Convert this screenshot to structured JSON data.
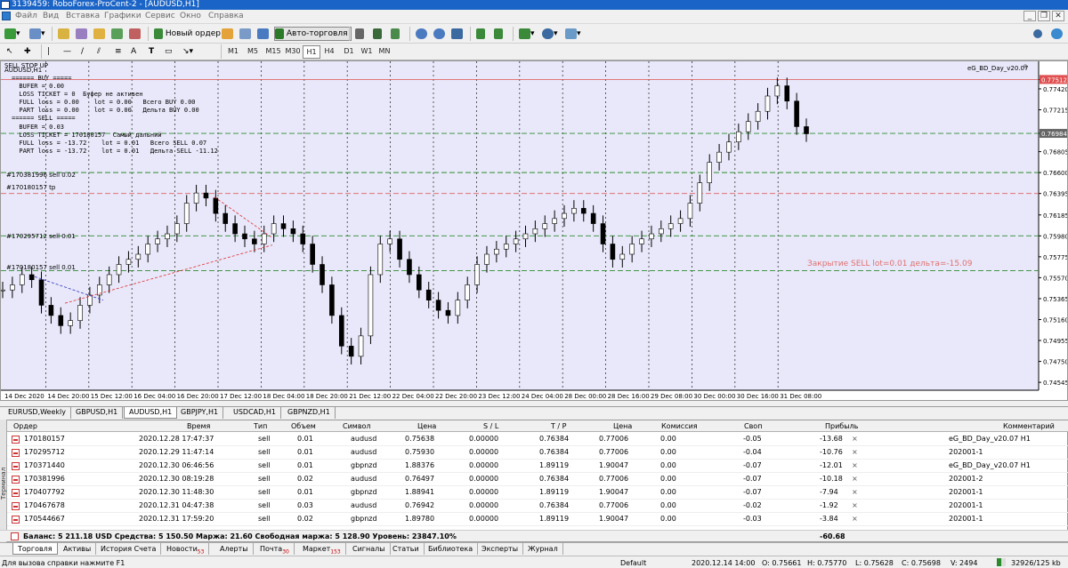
{
  "window": {
    "title": "3139459: RoboForex-ProCent-2 - [AUDUSD,H1]"
  },
  "menu": [
    "Файл",
    "Вид",
    "Вставка",
    "Графики",
    "Сервис",
    "Окно",
    "Справка"
  ],
  "toolbar": {
    "new_order": "Новый ордер",
    "auto_trading": "Авто-торговля",
    "timeframes": [
      "M1",
      "M5",
      "M15",
      "M30",
      "H1",
      "H4",
      "D1",
      "W1",
      "MN"
    ],
    "active_timeframe": "H1"
  },
  "chart": {
    "header": "SELL STOP UP",
    "symbol_line": "AUDUSD,H1",
    "expert_label": "eG_BD_Day_v20.07",
    "price_ticks": [
      "0.77512",
      "0.77420",
      "0.77215",
      "0.76984",
      "0.76805",
      "0.76600",
      "0.76395",
      "0.76185",
      "0.75980",
      "0.75775",
      "0.75570",
      "0.75365",
      "0.75160",
      "0.74955",
      "0.74750",
      "0.74545"
    ],
    "bid_price": "0.76984",
    "red_price": "0.77512",
    "time_ticks": [
      "14 Dec 2020",
      "14 Dec 20:00",
      "15 Dec 12:00",
      "16 Dec 04:00",
      "16 Dec 20:00",
      "17 Dec 12:00",
      "18 Dec 04:00",
      "18 Dec 20:00",
      "21 Dec 12:00",
      "22 Dec 04:00",
      "22 Dec 20:00",
      "23 Dec 12:00",
      "24 Dec 04:00",
      "28 Dec 00:00",
      "28 Dec 16:00",
      "29 Dec 08:00",
      "30 Dec 00:00",
      "30 Dec 16:00",
      "31 Dec 08:00"
    ],
    "buy_block": [
      "====== BUY =====",
      "  BUFER = 0.00",
      "  LOSS TICKET = 0  Буфер не активен",
      "  FULL loss = 0.00    lot = 0.00   Всего BUY 0.00",
      "  PART loss = 0.00    lot = 0.00   Дельта BUY 0.00",
      "====== SELL ====="
    ],
    "sell_block": [
      "  BUFER = 0.03",
      "  LOSS TICKET = 170180157  Самый дальний",
      "  FULL loss = -13.72    lot = 0.01   Всего SELL 0.07",
      "  PART loss = -13.72    lot = 0.01   Дельта SELL -11.12"
    ],
    "line_labels": [
      "#170381996 sell 0.02",
      "#170180157 tp",
      "#170295712 sell 0.01",
      "#170180157 sell 0.01"
    ],
    "close_note": "Закрытие SELL lot=0.01 дельта=-15.09",
    "colors": {
      "bg": "#ffffff",
      "grid": "#000000",
      "candle": "#000000",
      "hline_green": "#2e8b2e",
      "hline_red": "#e06060",
      "bid_line": "#555555"
    }
  },
  "symbol_tabs": [
    "EURUSD,Weekly",
    "GBPUSD,H1",
    "AUDUSD,H1",
    "GBPJPY,H1",
    "USDCAD,H1",
    "GBPNZD,H1"
  ],
  "active_symbol_tab": "AUDUSD,H1",
  "terminal": {
    "columns": [
      "Ордер",
      "Время",
      "Тип",
      "Объем",
      "Символ",
      "Цена",
      "S / L",
      "T / P",
      "Цена",
      "Комиссия",
      "Своп",
      "Прибыль",
      "Комментарий"
    ],
    "rows": [
      [
        "170180157",
        "2020.12.28 17:47:37",
        "sell",
        "0.01",
        "audusd",
        "0.75638",
        "0.00000",
        "0.76384",
        "0.77006",
        "0.00",
        "-0.05",
        "-13.68",
        "eG_BD_Day_v20.07 H1"
      ],
      [
        "170295712",
        "2020.12.29 11:47:14",
        "sell",
        "0.01",
        "audusd",
        "0.75930",
        "0.00000",
        "0.76384",
        "0.77006",
        "0.00",
        "-0.04",
        "-10.76",
        "202001-1"
      ],
      [
        "170371440",
        "2020.12.30 06:46:56",
        "sell",
        "0.01",
        "gbpnzd",
        "1.88376",
        "0.00000",
        "1.89119",
        "1.90047",
        "0.00",
        "-0.07",
        "-12.01",
        "eG_BD_Day_v20.07 H1"
      ],
      [
        "170381996",
        "2020.12.30 08:19:28",
        "sell",
        "0.02",
        "audusd",
        "0.76497",
        "0.00000",
        "0.76384",
        "0.77006",
        "0.00",
        "-0.07",
        "-10.18",
        "202001-2"
      ],
      [
        "170407792",
        "2020.12.30 11:48:30",
        "sell",
        "0.01",
        "gbpnzd",
        "1.88941",
        "0.00000",
        "1.89119",
        "1.90047",
        "0.00",
        "-0.07",
        "-7.94",
        "202001-1"
      ],
      [
        "170467678",
        "2020.12.31 04:47:38",
        "sell",
        "0.03",
        "audusd",
        "0.76942",
        "0.00000",
        "0.76384",
        "0.77006",
        "0.00",
        "-0.02",
        "-1.92",
        "202001-1"
      ],
      [
        "170544667",
        "2020.12.31 17:59:20",
        "sell",
        "0.02",
        "gbpnzd",
        "1.89780",
        "0.00000",
        "1.89119",
        "1.90047",
        "0.00",
        "-0.03",
        "-3.84",
        "202001-1"
      ]
    ],
    "balance_line": "Баланс: 5 211.18 USD  Средства: 5 150.50  Маржа: 21.60  Свободная маржа: 5 128.90  Уровень: 23847.10%",
    "total_profit": "-60.68",
    "side_label": "Терминал"
  },
  "bottom_tabs": [
    {
      "label": "Торговля",
      "badge": ""
    },
    {
      "label": "Активы",
      "badge": ""
    },
    {
      "label": "История Счета",
      "badge": ""
    },
    {
      "label": "Новости",
      "badge": "53"
    },
    {
      "label": "Алерты",
      "badge": ""
    },
    {
      "label": "Почта",
      "badge": "30"
    },
    {
      "label": "Маркет",
      "badge": "153"
    },
    {
      "label": "Сигналы",
      "badge": ""
    },
    {
      "label": "Статьи",
      "badge": ""
    },
    {
      "label": "Библиотека",
      "badge": ""
    },
    {
      "label": "Эксперты",
      "badge": ""
    },
    {
      "label": "Журнал",
      "badge": ""
    }
  ],
  "statusbar": {
    "help": "Для вызова справки нажмите F1",
    "profile": "Default",
    "datetime": "2020.12.14 14:00",
    "open": "O: 0.75661",
    "high": "H: 0.75770",
    "low": "L: 0.75628",
    "close": "C: 0.75698",
    "volume": "V: 2494",
    "traffic": "32926/125 kb"
  }
}
